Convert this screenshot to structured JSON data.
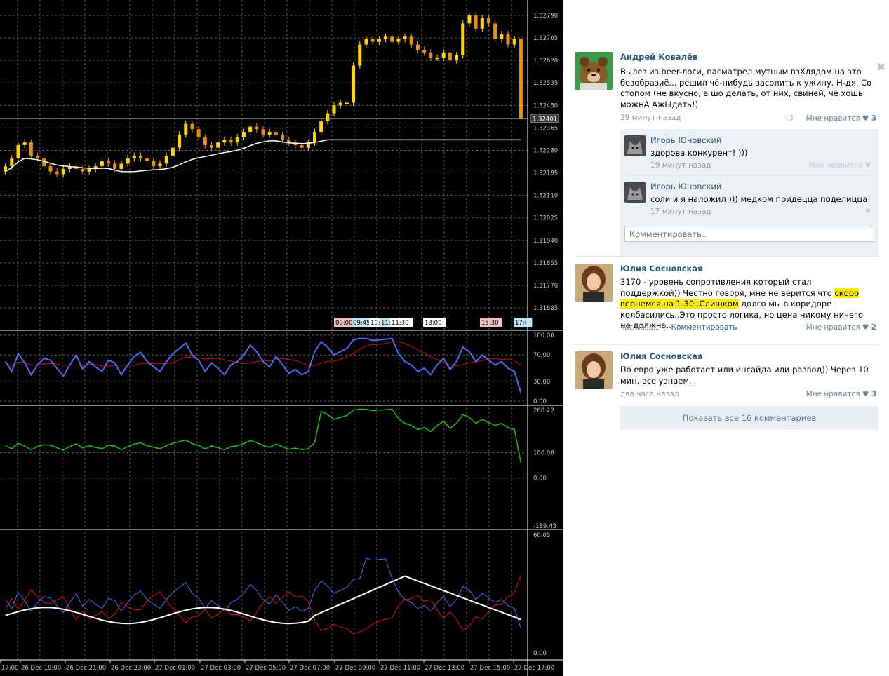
{
  "chart": {
    "price_axis": [
      "1.32790",
      "1.32705",
      "1.32620",
      "1.32535",
      "1.32450",
      "1.32365",
      "1.32280",
      "1.32195",
      "1.32110",
      "1.32025",
      "1.31940",
      "1.31855",
      "1.31770",
      "1.31685"
    ],
    "current_price": "1.32401",
    "time_markers": [
      "09:00",
      "09:45",
      "10:",
      "11:",
      "11:30",
      "13:00",
      "15:30",
      "17:("
    ],
    "rsi_axis": [
      "100.00",
      "70.00",
      "30.00",
      "0.00"
    ],
    "cci_axis": [
      "268.22",
      "100.00",
      "0.00",
      "-189.43"
    ],
    "adx_axis": [
      "60.05",
      "0.00"
    ],
    "time_axis": [
      "17:00",
      "26 Dec 19:00",
      "26 Dec 21:00",
      "26 Dec 23:00",
      "27 Dec 01:00",
      "27 Dec 03:00",
      "27 Dec 05:00",
      "27 Dec 07:00",
      "27 Dec 09:00",
      "27 Dec 11:00",
      "27 Dec 13:00",
      "27 Dec 15:00",
      "27 Dec 17:00"
    ]
  },
  "feed": {
    "posts": [
      {
        "author": "Андрей Ковалёв",
        "text": "Вылез из beer-логи, пасматрел мутным взХлядом на это безобразиё... решил чё-нибудь засолить к ужину. Н-дя. Со стопом (не вкусно, а шо делать, от них, свиней, чё хошь можнА АжЫдать!)",
        "time": "29 минут назад",
        "like_label": "Мне нравится",
        "like_count": "3",
        "replies": [
          {
            "author": "Игорь Юновский",
            "text": "здорова конкурент! )))",
            "time": "19 минут назад",
            "like_label": "Мне нравится"
          },
          {
            "author": "Игорь Юновский",
            "text": "соли и я наложил ))) медком придецца поделицца!",
            "time": "17 минут назад"
          }
        ],
        "comment_placeholder": "Комментировать.."
      },
      {
        "author": "Юлия Сосновская",
        "text_before": "3170 - уровень сопротивления который стал поддержкой)) Честно говоря, мне не верится что ",
        "text_highlight": "скоро вернемся на 1.30..Слишком",
        "text_after": " долго мы в коридоре колбасились..Это просто логика, но цена никому ничего не должна..",
        "time": "час назад",
        "comment_link": "Комментировать",
        "like_label": "Мне нравится",
        "like_count": "2"
      },
      {
        "author": "Юлия Сосновская",
        "text": "По евро уже работает или инсайда или развод)) Через 10 мин. все узнаем..",
        "time": "два часа назад",
        "like_label": "Мне нравится",
        "like_count": "3"
      }
    ],
    "show_all": "Показать все 16 комментариев"
  },
  "colors": {
    "chart_bg": "#000000",
    "bull_candle": "#ffd400",
    "bear_candle": "#e8900f",
    "rsi_line": "#4a6cf0",
    "signal_red": "#d01010",
    "cci_line": "#19c019",
    "adx_white": "#ffffff",
    "link_blue": "#2b587a",
    "highlight": "#ffee00"
  }
}
